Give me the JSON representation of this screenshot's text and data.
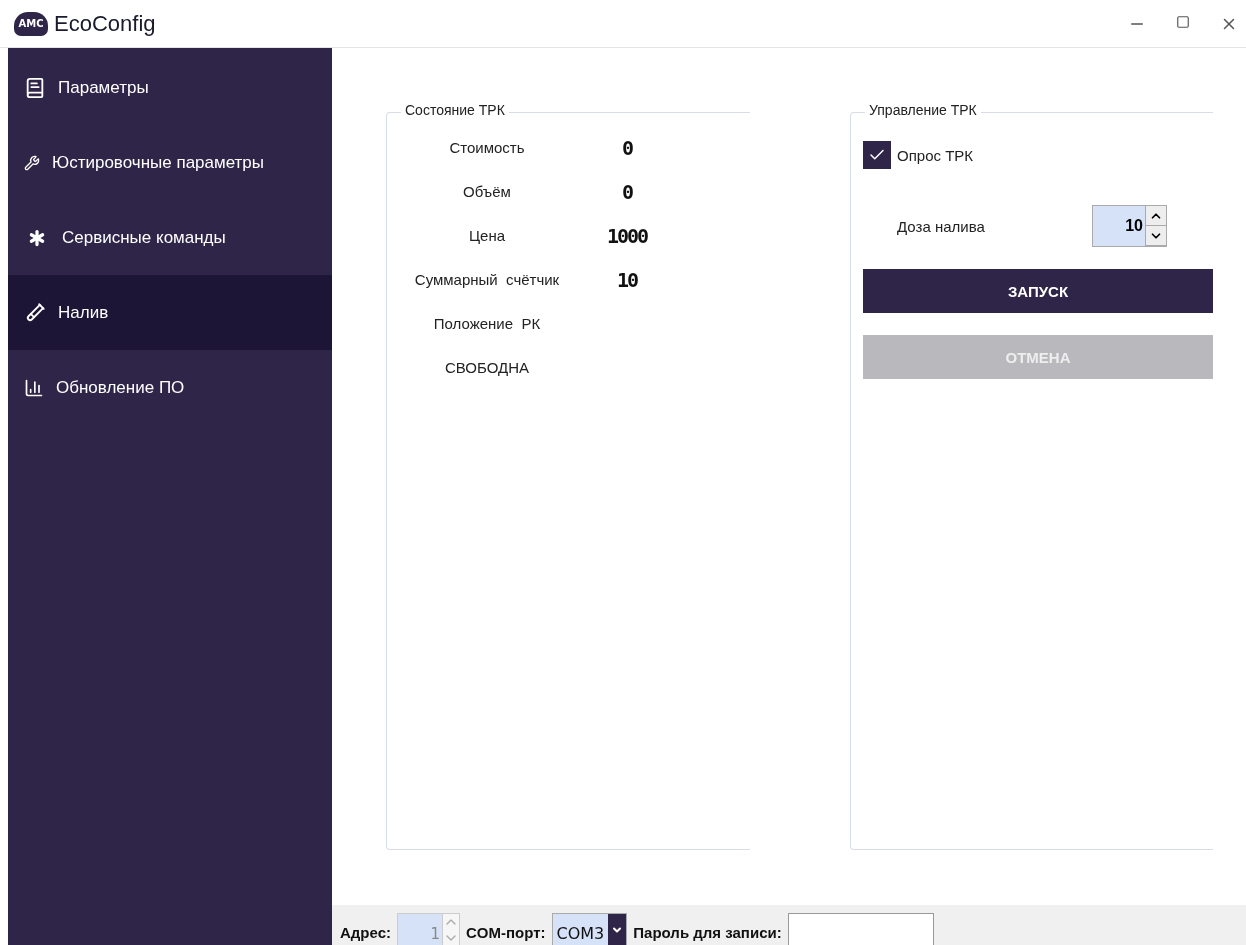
{
  "window": {
    "title": "EcoConfig",
    "logo_text": "AMC"
  },
  "sidebar": {
    "items": [
      {
        "label": "Параметры",
        "kind": "book",
        "selected": false
      },
      {
        "label": "Юстировочные параметры",
        "kind": "tools",
        "selected": false
      },
      {
        "label": "Сервисные команды",
        "kind": "asterisk",
        "selected": false
      },
      {
        "label": "Налив",
        "kind": "tube",
        "selected": true
      },
      {
        "label": "Обновление ПО",
        "kind": "chart",
        "selected": false
      }
    ]
  },
  "status_group": {
    "title": "Состояние ТРК",
    "rows": [
      {
        "label": "Стоимость",
        "value": "0"
      },
      {
        "label": "Объём",
        "value": "0"
      },
      {
        "label": "Цена",
        "value": "1000"
      },
      {
        "label": "Суммарный  счётчик",
        "value": "10"
      },
      {
        "label": "Положение  РК"
      },
      {
        "label": "СВОБОДНА"
      }
    ]
  },
  "control_group": {
    "title": "Управление ТРК",
    "poll": {
      "label": "Опрос ТРК",
      "checked": true
    },
    "dose": {
      "label": "Доза налива",
      "value": "10"
    },
    "buttons": [
      {
        "label": "ЗАПУСК",
        "disabled": false
      },
      {
        "label": "ОТМЕНА",
        "disabled": true
      }
    ]
  },
  "bottom_bar": {
    "address_label": "Адрес:",
    "address_value": "1",
    "port_label": "COM-порт:",
    "port_value": "COM3",
    "password_label": "Пароль для записи:"
  }
}
